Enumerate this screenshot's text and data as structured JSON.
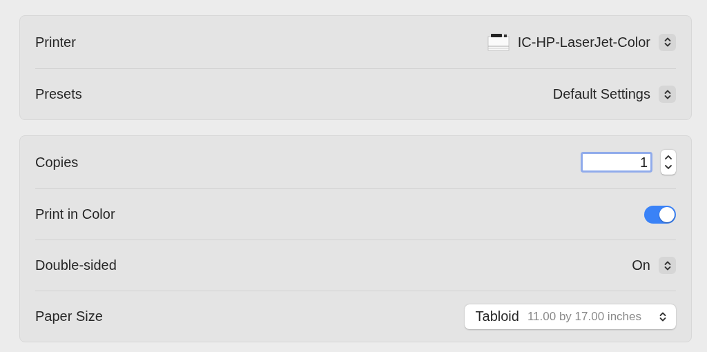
{
  "groups": [
    {
      "rows": [
        {
          "kind": "device-popup",
          "label": "Printer",
          "value": "IC-HP-LaserJet-Color"
        },
        {
          "kind": "popup",
          "label": "Presets",
          "value": "Default Settings"
        }
      ]
    },
    {
      "rows": [
        {
          "kind": "stepper",
          "label": "Copies",
          "value": "1"
        },
        {
          "kind": "toggle",
          "label": "Print in Color",
          "on": true
        },
        {
          "kind": "popup",
          "label": "Double-sided",
          "value": "On"
        },
        {
          "kind": "menu",
          "label": "Paper Size",
          "value": "Tabloid",
          "detail": "11.00 by 17.00 inches"
        }
      ]
    }
  ]
}
